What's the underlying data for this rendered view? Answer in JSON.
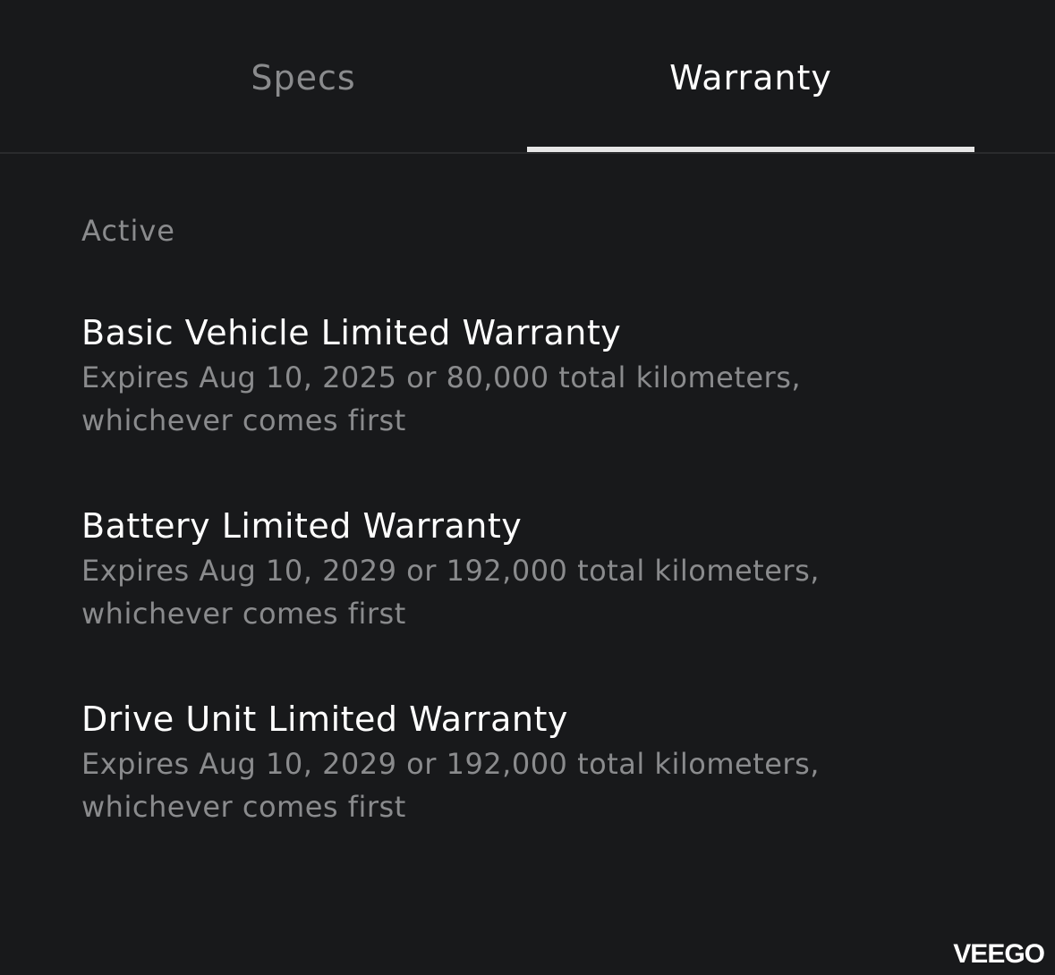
{
  "tabs": [
    {
      "label": "Specs",
      "active": false
    },
    {
      "label": "Warranty",
      "active": true
    }
  ],
  "section": {
    "label": "Active"
  },
  "warranties": [
    {
      "title": "Basic Vehicle Limited Warranty",
      "description": "Expires Aug 10, 2025 or 80,000 total kilometers, whichever comes first"
    },
    {
      "title": "Battery Limited Warranty",
      "description": "Expires Aug 10, 2029 or 192,000 total kilometers, whichever comes first"
    },
    {
      "title": "Drive Unit Limited Warranty",
      "description": "Expires Aug 10, 2029 or 192,000 total kilometers, whichever comes first"
    }
  ],
  "watermark": "VEEGO",
  "colors": {
    "background": "#18191b",
    "active_text": "#ffffff",
    "inactive_text": "#8a8b8d",
    "indicator": "#e6e6e6"
  }
}
